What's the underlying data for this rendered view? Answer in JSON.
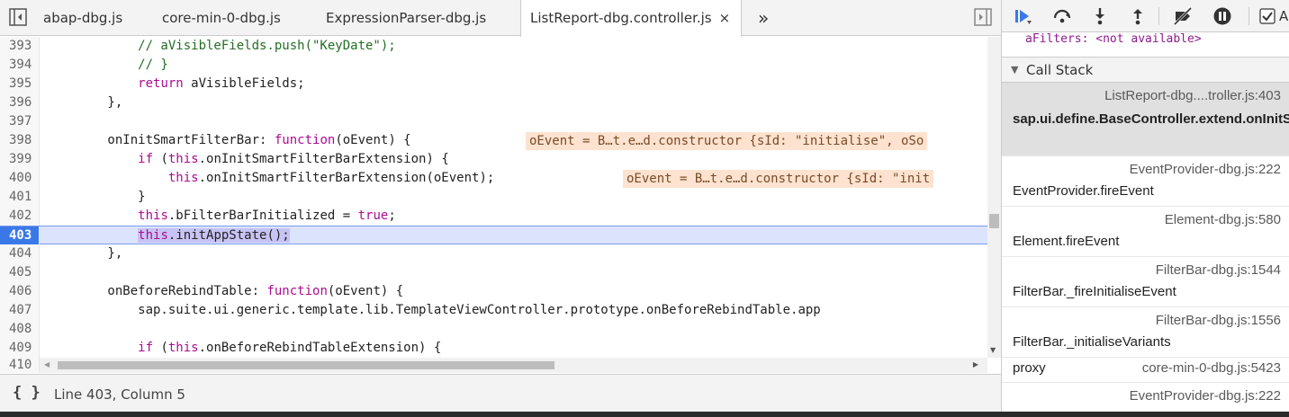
{
  "tabs": [
    {
      "label": "abap-dbg.js",
      "active": false
    },
    {
      "label": "core-min-0-dbg.js",
      "active": false
    },
    {
      "label": "ExpressionParser-dbg.js",
      "active": false
    },
    {
      "label": "ListReport-dbg.controller.js",
      "active": true
    }
  ],
  "tab_close_glyph": "×",
  "tab_overflow_glyph": "»",
  "code": {
    "current_line": 403,
    "lines": [
      {
        "n": "393",
        "t": "            // aVisibleFields.push(\"KeyDate\");"
      },
      {
        "n": "394",
        "t": "            // }"
      },
      {
        "n": "395",
        "t": "            return aVisibleFields;"
      },
      {
        "n": "396",
        "t": "        },"
      },
      {
        "n": "397",
        "t": ""
      },
      {
        "n": "398",
        "t": "        onInitSmartFilterBar: function(oEvent) {"
      },
      {
        "n": "399",
        "t": "            if (this.onInitSmartFilterBarExtension) {"
      },
      {
        "n": "400",
        "t": "                this.onInitSmartFilterBarExtension(oEvent);"
      },
      {
        "n": "401",
        "t": "            }"
      },
      {
        "n": "402",
        "t": "            this.bFilterBarInitialized = true;"
      },
      {
        "n": "403",
        "t": "            this.initAppState();"
      },
      {
        "n": "404",
        "t": "        },"
      },
      {
        "n": "405",
        "t": ""
      },
      {
        "n": "406",
        "t": "        onBeforeRebindTable: function(oEvent) {"
      },
      {
        "n": "407",
        "t": "            sap.suite.ui.generic.template.lib.TemplateViewController.prototype.onBeforeRebindTable.app"
      },
      {
        "n": "408",
        "t": ""
      },
      {
        "n": "409",
        "t": "            if (this.onBeforeRebindTableExtension) {"
      },
      {
        "n": "410",
        "t": ""
      }
    ],
    "inline_values": {
      "line398": "oEvent = B…t.e…d.constructor {sId: \"initialise\", oSo",
      "line400": "oEvent = B…t.e…d.constructor {sId: \"init"
    }
  },
  "status": {
    "format_icon": "{ }",
    "position": "Line 403, Column 5"
  },
  "debugger": {
    "scope_partial": "aFilters: <not available>",
    "callstack_title": "Call Stack",
    "frames": [
      {
        "location": "ListReport-dbg....troller.js:403",
        "function": "sap.ui.define.BaseController.extend.onInitSmartFilterBar",
        "selected": true
      },
      {
        "location": "EventProvider-dbg.js:222",
        "function": "EventProvider.fireEvent",
        "selected": false
      },
      {
        "location": "Element-dbg.js:580",
        "function": "Element.fireEvent",
        "selected": false
      },
      {
        "location": "FilterBar-dbg.js:1544",
        "function": "FilterBar._fireInitialiseEvent",
        "selected": false
      },
      {
        "location": "FilterBar-dbg.js:1556",
        "function": "FilterBar._initialiseVariants",
        "selected": false
      },
      {
        "location": "core-min-0-dbg.js:5423",
        "function": "proxy",
        "selected": false
      },
      {
        "location": "EventProvider-dbg.js:222",
        "function": "",
        "selected": false
      }
    ],
    "toolbar_checkbox_label": "A"
  },
  "colors": {
    "accent": "#3b78e7",
    "exec_line": "#dbe4fc",
    "inline_value_bg": "#fde3cf",
    "keyword": "#aa0d91",
    "comment": "#236e25",
    "string": "#1a1aa6"
  }
}
